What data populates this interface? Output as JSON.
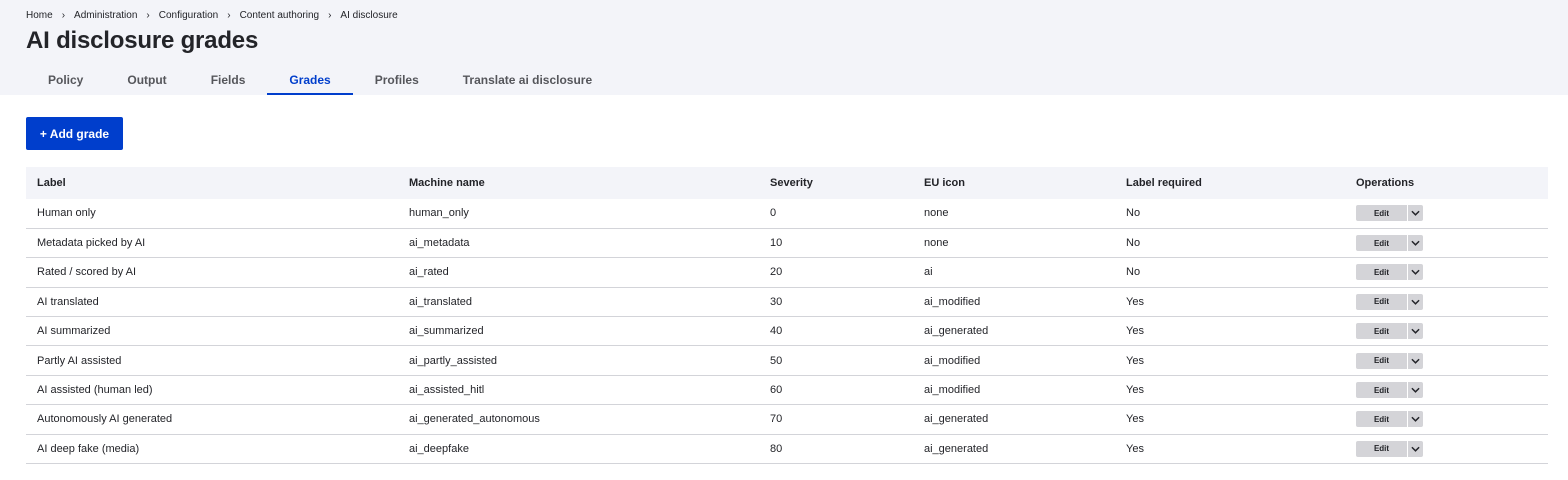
{
  "breadcrumb": [
    "Home",
    "Administration",
    "Configuration",
    "Content authoring",
    "AI disclosure"
  ],
  "breadcrumb_separator": "›",
  "page_title": "AI disclosure grades",
  "tabs": [
    {
      "label": "Policy",
      "active": false
    },
    {
      "label": "Output",
      "active": false
    },
    {
      "label": "Fields",
      "active": false
    },
    {
      "label": "Grades",
      "active": true
    },
    {
      "label": "Profiles",
      "active": false
    },
    {
      "label": "Translate ai disclosure",
      "active": false
    }
  ],
  "add_button_label": "+ Add grade",
  "table": {
    "headers": [
      "Label",
      "Machine name",
      "Severity",
      "EU icon",
      "Label required",
      "Operations"
    ],
    "rows": [
      {
        "label": "Human only",
        "machine_name": "human_only",
        "severity": "0",
        "eu_icon": "none",
        "label_required": "No",
        "operation": "Edit"
      },
      {
        "label": "Metadata picked by AI",
        "machine_name": "ai_metadata",
        "severity": "10",
        "eu_icon": "none",
        "label_required": "No",
        "operation": "Edit"
      },
      {
        "label": "Rated / scored by AI",
        "machine_name": "ai_rated",
        "severity": "20",
        "eu_icon": "ai",
        "label_required": "No",
        "operation": "Edit"
      },
      {
        "label": "AI translated",
        "machine_name": "ai_translated",
        "severity": "30",
        "eu_icon": "ai_modified",
        "label_required": "Yes",
        "operation": "Edit"
      },
      {
        "label": "AI summarized",
        "machine_name": "ai_summarized",
        "severity": "40",
        "eu_icon": "ai_generated",
        "label_required": "Yes",
        "operation": "Edit"
      },
      {
        "label": "Partly AI assisted",
        "machine_name": "ai_partly_assisted",
        "severity": "50",
        "eu_icon": "ai_modified",
        "label_required": "Yes",
        "operation": "Edit"
      },
      {
        "label": "AI assisted (human led)",
        "machine_name": "ai_assisted_hitl",
        "severity": "60",
        "eu_icon": "ai_modified",
        "label_required": "Yes",
        "operation": "Edit"
      },
      {
        "label": "Autonomously AI generated",
        "machine_name": "ai_generated_autonomous",
        "severity": "70",
        "eu_icon": "ai_generated",
        "label_required": "Yes",
        "operation": "Edit"
      },
      {
        "label": "AI deep fake (media)",
        "machine_name": "ai_deepfake",
        "severity": "80",
        "eu_icon": "ai_generated",
        "label_required": "Yes",
        "operation": "Edit"
      }
    ]
  },
  "icons": {
    "dropdown": "chevron-down-icon"
  },
  "colors": {
    "accent": "#003ecc",
    "header_bg": "#f3f4f9",
    "button_gray": "#d4d4d8",
    "text": "#232429"
  }
}
